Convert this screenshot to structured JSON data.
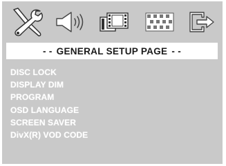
{
  "header": {
    "dash_left": "- -",
    "title": "GENERAL SETUP PAGE",
    "dash_right": "- -"
  },
  "tabs": [
    {
      "icon": "tools-icon",
      "active": true
    },
    {
      "icon": "speaker-icon",
      "active": false
    },
    {
      "icon": "video-icon",
      "active": false
    },
    {
      "icon": "pattern-icon",
      "active": false
    },
    {
      "icon": "exit-icon",
      "active": false
    }
  ],
  "menu": {
    "items": [
      "DISC LOCK",
      "DISPLAY DIM",
      "PROGRAM",
      "OSD LANGUAGE",
      "SCREEN SAVER",
      "DivX(R) VOD CODE"
    ]
  },
  "colors": {
    "panel": "#c9c9c9",
    "title_bg": "#ffffff",
    "menu_text": "#ffffff",
    "icon_fill": "#ffffff",
    "icon_outline": "#333333"
  }
}
